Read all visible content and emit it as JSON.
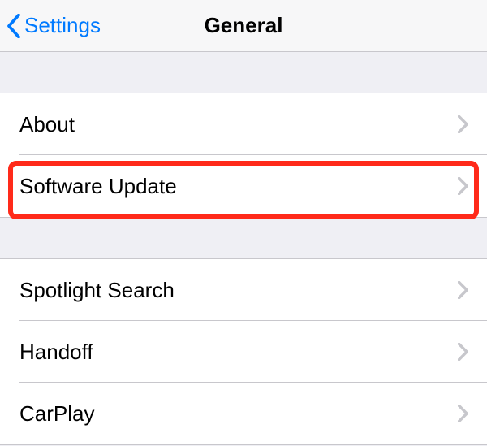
{
  "header": {
    "back_label": "Settings",
    "title": "General"
  },
  "sections": [
    {
      "rows": [
        {
          "label": "About"
        },
        {
          "label": "Software Update"
        }
      ]
    },
    {
      "rows": [
        {
          "label": "Spotlight Search"
        },
        {
          "label": "Handoff"
        },
        {
          "label": "CarPlay"
        }
      ]
    }
  ]
}
